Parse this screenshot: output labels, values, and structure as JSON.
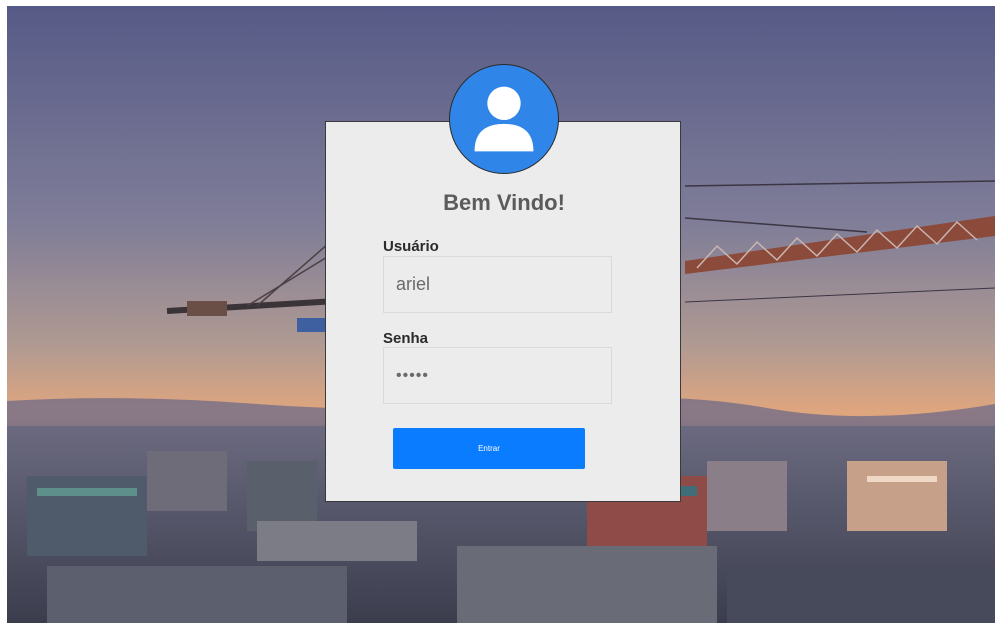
{
  "login": {
    "title": "Bem Vindo!",
    "username_label": "Usuário",
    "username_value": "ariel",
    "password_label": "Senha",
    "password_value": "12345",
    "submit_label": "Entrar"
  },
  "icons": {
    "avatar": "user-avatar-icon"
  },
  "colors": {
    "accent": "#0a7cff",
    "avatar_bg": "#2f86e8",
    "card_bg": "#ececec",
    "title": "#5b5b5b"
  }
}
